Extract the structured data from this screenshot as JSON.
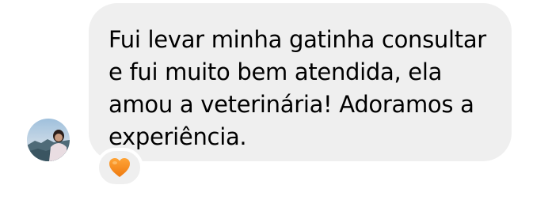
{
  "comment": {
    "text": "Fui levar minha gatinha consultar e fui muito bem atendida, ela amou a veterinária! Adoramos a experiência.",
    "reaction_icon": "orange-heart-icon",
    "reaction_color": "#f28b1e",
    "bubble_color": "#efefef",
    "avatar_icon": "user-avatar-photo"
  }
}
